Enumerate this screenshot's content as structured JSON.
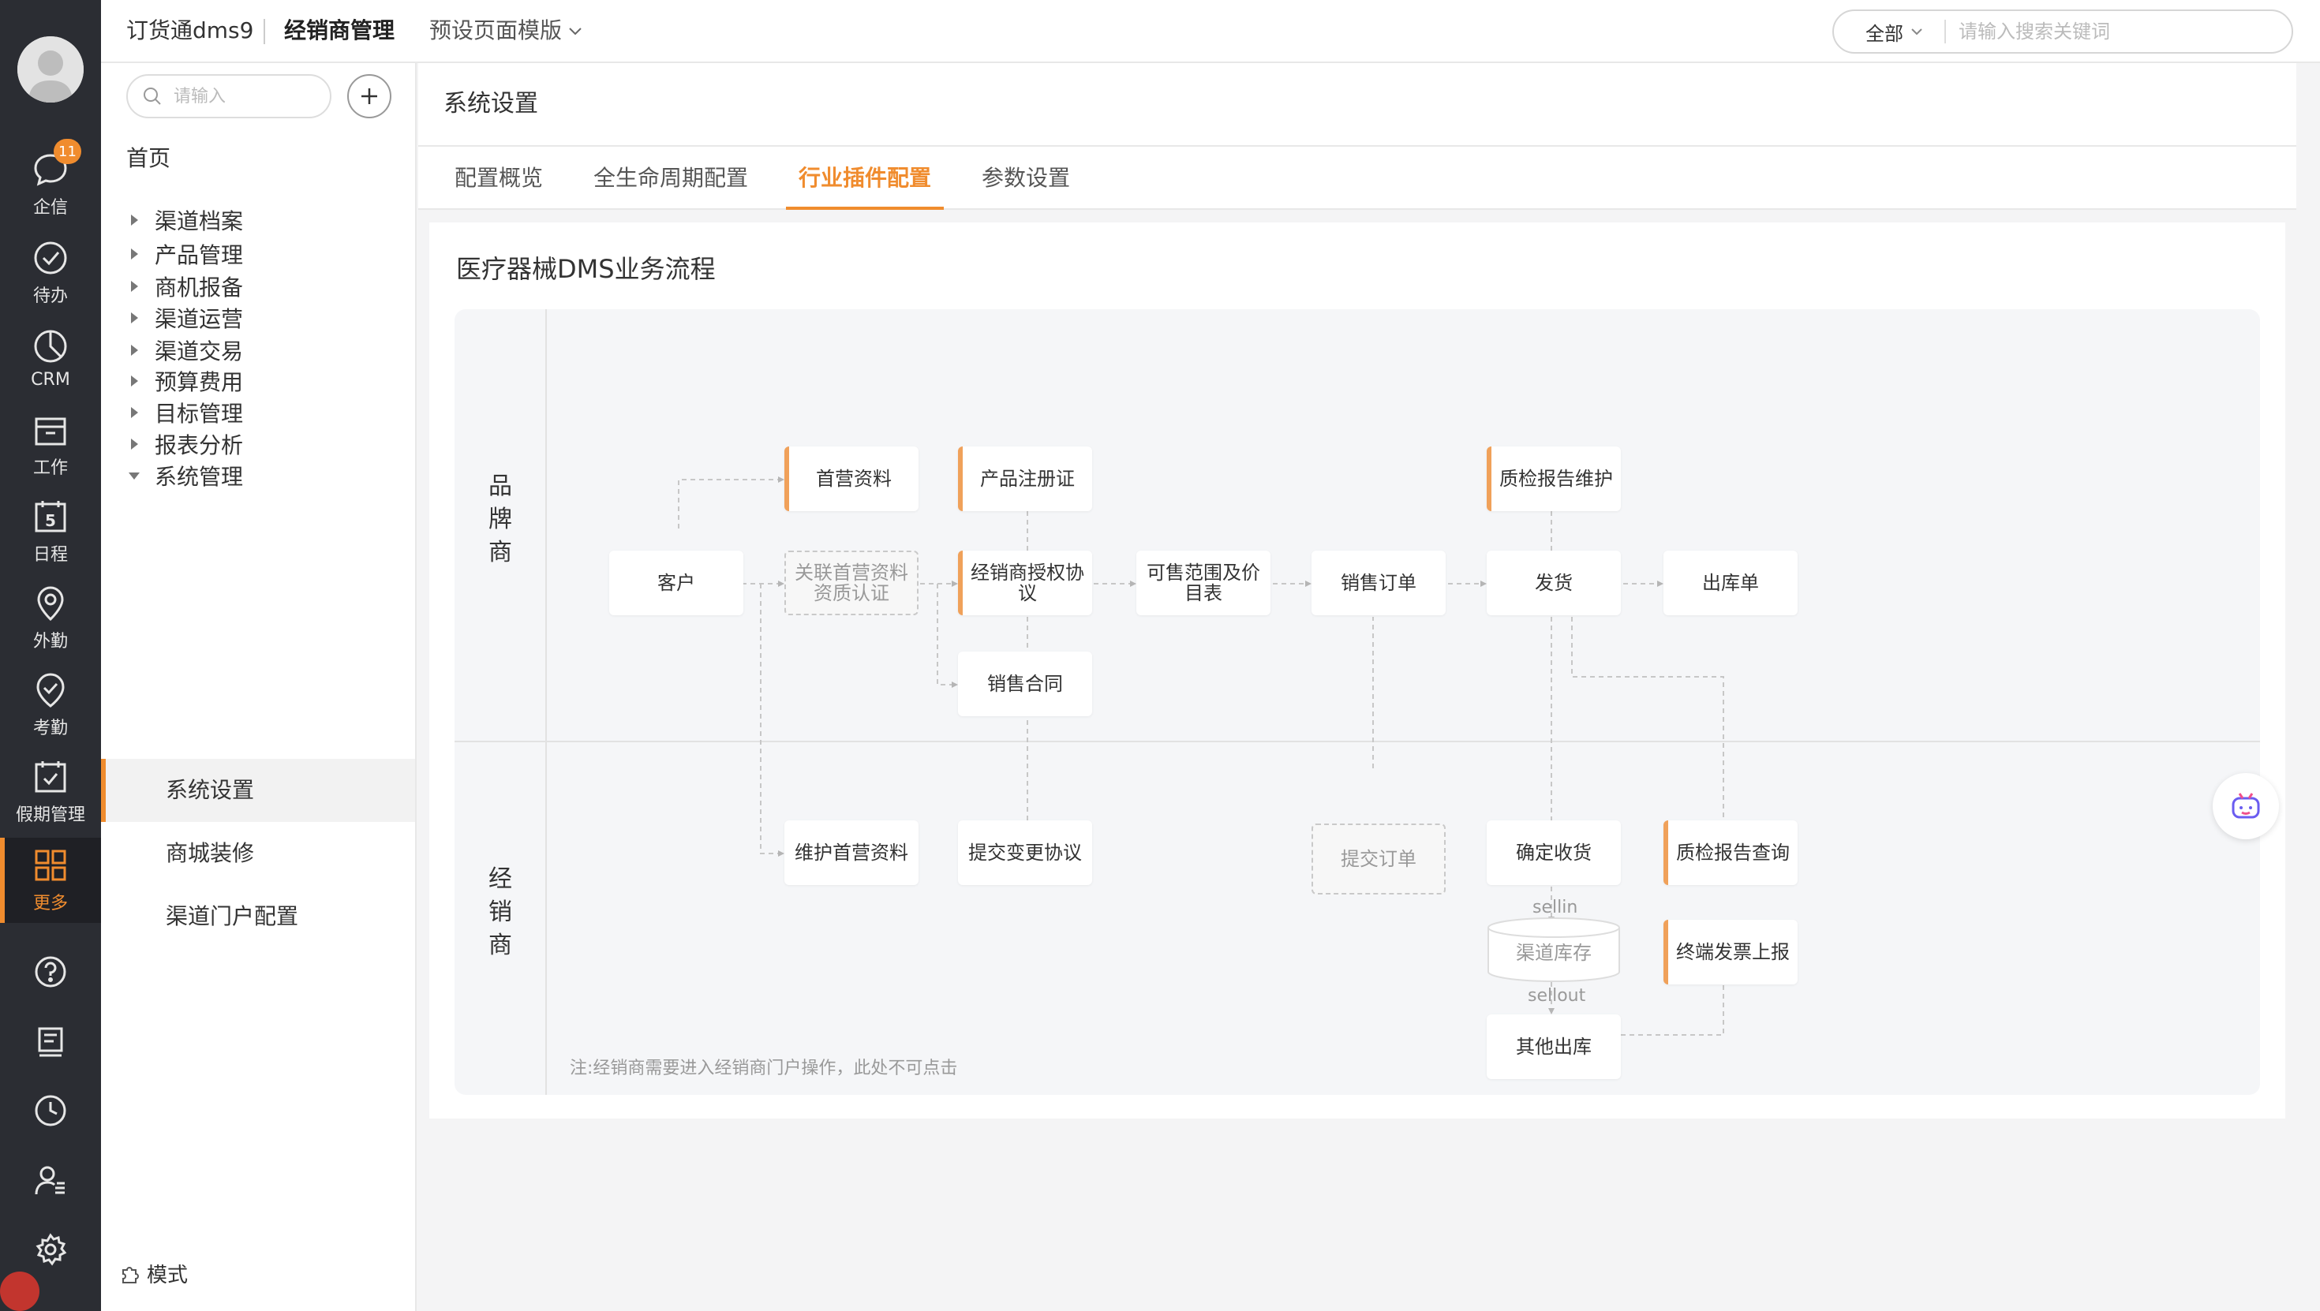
{
  "rail": {
    "items": [
      {
        "label": "企信",
        "badge": "11"
      },
      {
        "label": "待办"
      },
      {
        "label": "CRM"
      },
      {
        "label": "工作"
      },
      {
        "label": "日程",
        "icon_text": "5"
      },
      {
        "label": "外勤"
      },
      {
        "label": "考勤"
      },
      {
        "label": "假期管理"
      },
      {
        "label": "更多"
      }
    ]
  },
  "header": {
    "app_name": "订货通dms9",
    "module": "经销商管理",
    "template": "预设页面模版",
    "search_scope": "全部",
    "search_placeholder": "请输入搜索关键词"
  },
  "nav": {
    "search_placeholder": "请输入",
    "home": "首页",
    "groups": [
      "渠道档案",
      "产品管理",
      "商机报备",
      "渠道运营",
      "渠道交易",
      "预算费用",
      "目标管理",
      "报表分析",
      "系统管理"
    ],
    "sub_items": [
      "系统设置",
      "商城装修",
      "渠道门户配置"
    ],
    "mode": "模式"
  },
  "main": {
    "page_title": "系统设置",
    "tabs": [
      "配置概览",
      "全生命周期配置",
      "行业插件配置",
      "参数设置"
    ],
    "active_tab": "行业插件配置",
    "card_title": "医疗器械DMS业务流程",
    "lanes": {
      "brand": "品\n牌\n商",
      "dealer": "经\n销\n商"
    },
    "nodes": {
      "customer": "客户",
      "first_data": "首营资料",
      "link_first": "关联首营资料资质认证",
      "product_reg": "产品注册证",
      "dealer_auth": "经销商授权协议",
      "sales_contract": "销售合同",
      "sale_scope": "可售范围及价目表",
      "sales_order": "销售订单",
      "qc_maintain": "质检报告维护",
      "ship": "发货",
      "outbound": "出库单",
      "maintain_first": "维护首营资料",
      "submit_change": "提交变更协议",
      "submit_order": "提交订单",
      "confirm_receipt": "确定收货",
      "qc_query": "质检报告查询",
      "channel_stock": "渠道库存",
      "terminal_invoice": "终端发票上报",
      "other_outbound": "其他出库"
    },
    "edge_labels": {
      "sellin": "sellin",
      "sellout": "sellout"
    },
    "note": "注:经销商需要进入经销商门户操作，此处不可点击"
  },
  "colors": {
    "accent": "#f08c2e",
    "rail_bg": "#2b2d33",
    "node_accent": "#f0a15a"
  }
}
